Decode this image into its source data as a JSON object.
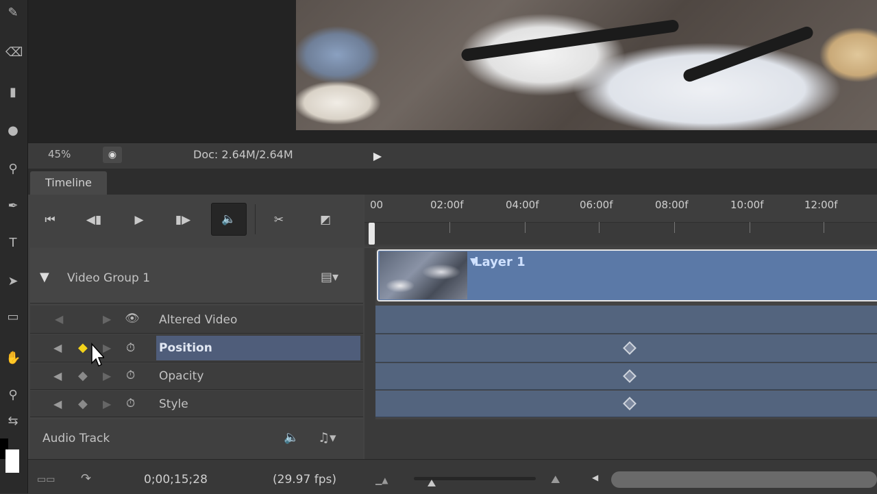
{
  "statusbar": {
    "zoom": "45%",
    "doc": "Doc: 2.64M/2.64M"
  },
  "timeline": {
    "tab_label": "Timeline",
    "ruler_labels": [
      "00",
      "02:00f",
      "04:00f",
      "06:00f",
      "08:00f",
      "10:00f",
      "12:00f"
    ],
    "group_label": "Video Group 1",
    "clip_label": "Layer 1",
    "properties": [
      {
        "label": "Altered Video"
      },
      {
        "label": "Position",
        "selected": true
      },
      {
        "label": "Opacity"
      },
      {
        "label": "Style"
      }
    ],
    "audio_label": "Audio Track",
    "timecode": "0;00;15;28",
    "fps": "(29.97 fps)"
  },
  "colors": {
    "clip": "#5b79a7",
    "lane": "#53647e",
    "selected_row": "#4f5d7a",
    "keyframe_active": "#f3d31b"
  },
  "icons": {
    "controls": [
      "go-to-first-frame-icon",
      "previous-frame-icon",
      "play-icon",
      "next-frame-icon",
      "audio-icon",
      "split-icon",
      "transition-icon"
    ]
  }
}
